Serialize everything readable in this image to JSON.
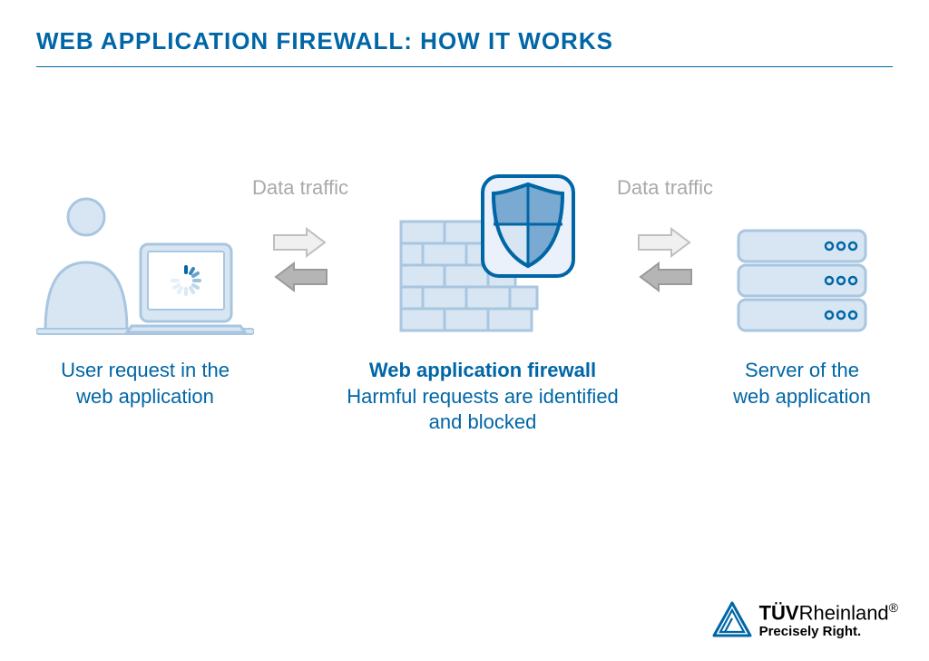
{
  "title": "WEB APPLICATION FIREWALL: HOW IT WORKS",
  "flow_label_left": "Data traffic",
  "flow_label_right": "Data traffic",
  "user": {
    "caption_line1": "User request in the",
    "caption_line2": "web application"
  },
  "waf": {
    "caption_title": "Web application firewall",
    "caption_line1": "Harmful requests are identified",
    "caption_line2": "and blocked"
  },
  "server": {
    "caption_line1": "Server of the",
    "caption_line2": "web application"
  },
  "logo": {
    "brand_bold": "TÜV",
    "brand_rest": "Rheinland",
    "registered": "®",
    "tagline": "Precisely Right."
  },
  "colors": {
    "accent": "#0066a6",
    "light_fill": "#d8e6f3",
    "light_stroke": "#a9c6e0",
    "grey": "#a9a9a9",
    "grey_fill": "#b5b5b5"
  }
}
